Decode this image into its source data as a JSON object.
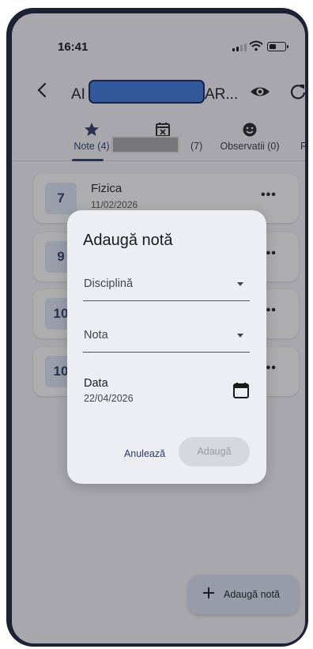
{
  "status_bar": {
    "time": "16:41"
  },
  "app_bar": {
    "title_prefix": "AI",
    "title_suffix": "AR..."
  },
  "tabs": [
    {
      "label": "Note (4)",
      "icon": "star-icon"
    },
    {
      "label": "(7)",
      "icon": "calendar-x-icon"
    },
    {
      "label": "Observatii (0)",
      "icon": "smiley-icon"
    },
    {
      "label": "F",
      "icon": ""
    }
  ],
  "grades": [
    {
      "value": "7",
      "subject": "Fizica",
      "date": "11/02/2026"
    },
    {
      "value": "9",
      "subject": "",
      "date": ""
    },
    {
      "value": "10",
      "subject": "",
      "date": ""
    },
    {
      "value": "10",
      "subject": "",
      "date": ""
    }
  ],
  "fab": {
    "label": "Adaugă notă"
  },
  "dialog": {
    "title": "Adaugă notă",
    "subject_placeholder": "Disciplină",
    "grade_placeholder": "Nota",
    "date_label": "Data",
    "date_value": "22/04/2026",
    "cancel_label": "Anulează",
    "add_label": "Adaugă"
  },
  "colors": {
    "accent": "#2b3a67",
    "badge_bg": "#dfe7f6",
    "redaction": "#3a78e0"
  }
}
